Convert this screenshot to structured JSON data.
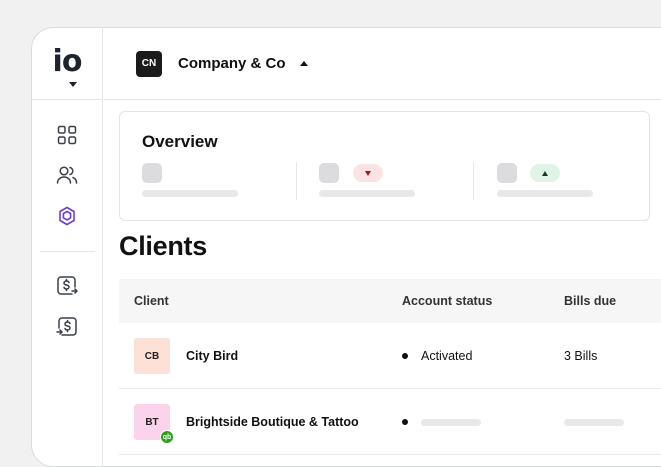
{
  "app": {
    "logo_text": "io"
  },
  "sidebar": {
    "items": [
      {
        "icon": "dashboard-grid-icon"
      },
      {
        "icon": "users-icon"
      },
      {
        "icon": "hexagon-icon",
        "active": true,
        "color": "#6b3ec9"
      },
      {
        "icon": "dollar-out-icon"
      },
      {
        "icon": "dollar-in-icon"
      }
    ]
  },
  "topbar": {
    "company_badge": "CN",
    "company_name": "Company & Co",
    "caret_icon": "caret-up-icon"
  },
  "overview": {
    "title": "Overview",
    "stats": [
      {
        "trend": null
      },
      {
        "trend": "down",
        "color": "#fbe3e3",
        "arrow_color": "#9b1c1c"
      },
      {
        "trend": "up",
        "color": "#dff3e6",
        "arrow_color": "#0f3d24"
      }
    ]
  },
  "clients": {
    "title": "Clients",
    "columns": [
      "Client",
      "Account status",
      "Bills due"
    ],
    "rows": [
      {
        "initials": "CB",
        "name": "City Bird",
        "status": "Activated",
        "bills": "3 Bills",
        "avatar_color": "#fde0d6"
      },
      {
        "initials": "BT",
        "name": "Brightside Boutique & Tattoo",
        "status": "",
        "bills": "",
        "avatar_color": "#fbd3ea",
        "integration_badge": "qb"
      }
    ]
  }
}
